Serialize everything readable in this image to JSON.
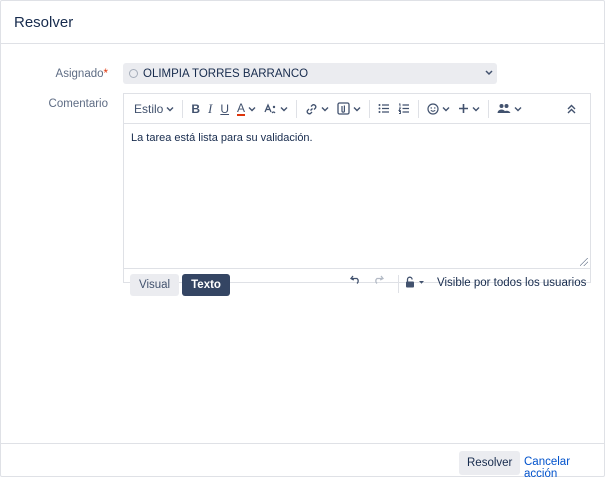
{
  "dialog": {
    "title": "Resolver"
  },
  "form": {
    "assignee_label": "Asignado",
    "required_marker": "*",
    "assignee_value": "OLIMPIA TORRES BARRANCO",
    "comment_label": "Comentario"
  },
  "editor": {
    "toolbar": {
      "style_label": "Estilo",
      "bold": "B",
      "italic": "I",
      "underline": "U",
      "text_color": "A"
    },
    "content": "La tarea está lista para su validación.",
    "modes": {
      "visual": "Visual",
      "text": "Texto"
    },
    "visibility": "Visible por todos los usuarios"
  },
  "footer": {
    "resolve_button": "Resolver",
    "cancel_link": "Cancelar acción"
  },
  "colors": {
    "accent": "#344563",
    "link": "#0052cc",
    "required": "#de350b",
    "text_color_bar": "#de350b"
  },
  "icons": [
    "chevron-down-icon",
    "bold-icon",
    "italic-icon",
    "underline-icon",
    "text-color-icon",
    "text-effects-icon",
    "link-icon",
    "attachment-icon",
    "bullet-list-icon",
    "numbered-list-icon",
    "emoji-icon",
    "plus-icon",
    "people-icon",
    "collapse-icon",
    "undo-icon",
    "redo-icon",
    "lock-icon",
    "resize-handle-icon"
  ]
}
